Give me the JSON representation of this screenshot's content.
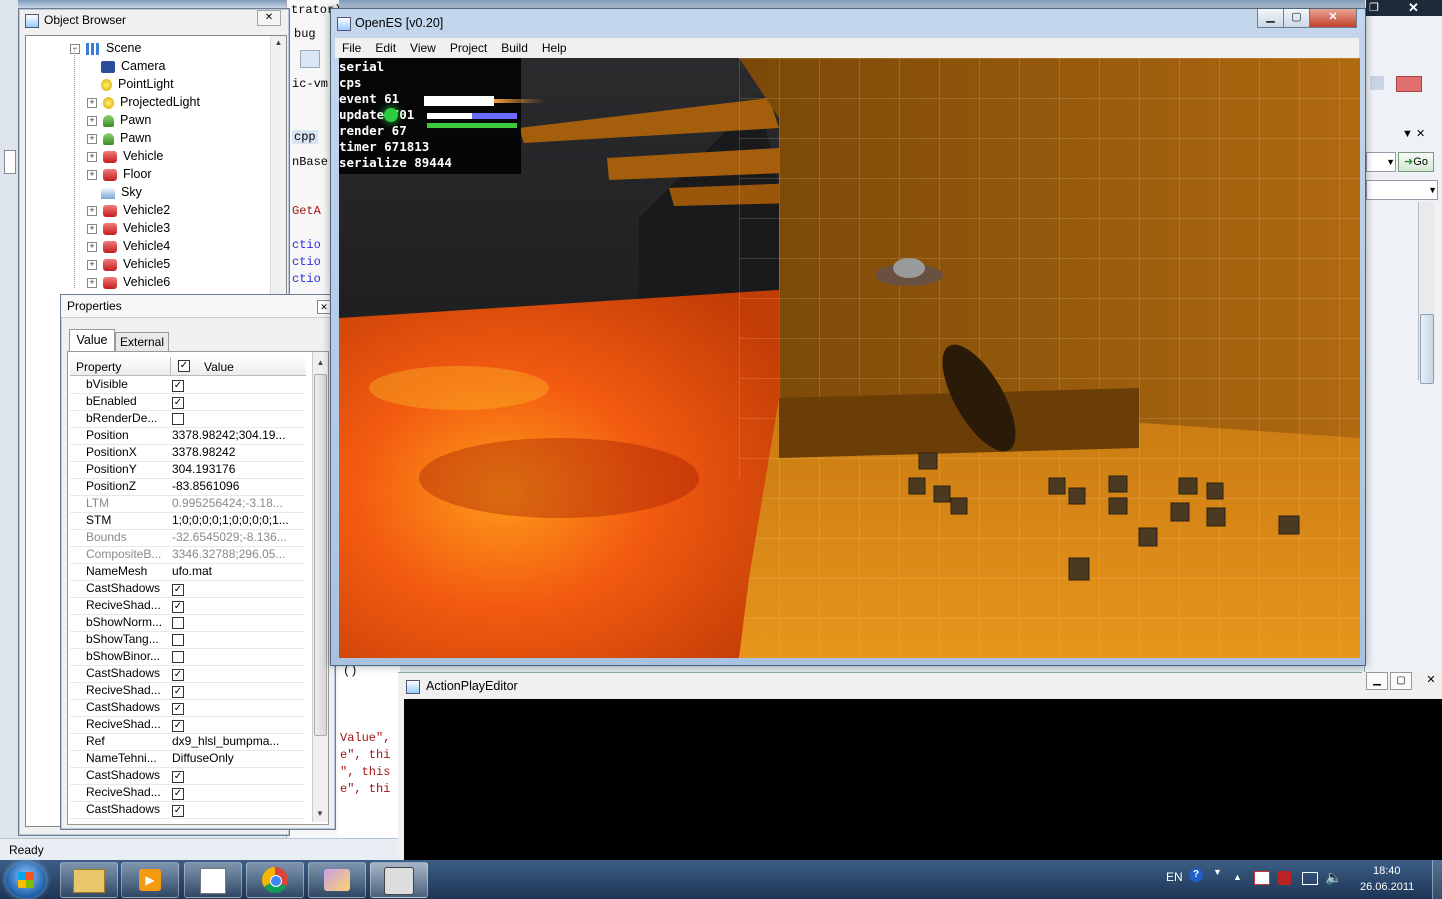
{
  "object_browser": {
    "title": "Object Browser",
    "close_label": "✕",
    "tree": [
      {
        "label": "Scene",
        "icon": "grid-icon",
        "indent": 0,
        "expander": "−"
      },
      {
        "label": "Camera",
        "icon": "camera-icon",
        "indent": 1,
        "expander": ""
      },
      {
        "label": "PointLight",
        "icon": "bulb-icon",
        "indent": 1,
        "expander": ""
      },
      {
        "label": "ProjectedLight",
        "icon": "bulb-icon",
        "indent": 1,
        "expander": "+"
      },
      {
        "label": "Pawn",
        "icon": "pawn-icon",
        "indent": 1,
        "expander": "+"
      },
      {
        "label": "Pawn",
        "icon": "pawn-icon",
        "indent": 1,
        "expander": "+"
      },
      {
        "label": "Vehicle",
        "icon": "car-icon",
        "indent": 1,
        "expander": "+"
      },
      {
        "label": "Floor",
        "icon": "car-icon",
        "indent": 1,
        "expander": "+"
      },
      {
        "label": "Sky",
        "icon": "sky-icon",
        "indent": 1,
        "expander": ""
      },
      {
        "label": "Vehicle2",
        "icon": "car-icon",
        "indent": 1,
        "expander": "+"
      },
      {
        "label": "Vehicle3",
        "icon": "car-icon",
        "indent": 1,
        "expander": "+"
      },
      {
        "label": "Vehicle4",
        "icon": "car-icon",
        "indent": 1,
        "expander": "+"
      },
      {
        "label": "Vehicle5",
        "icon": "car-icon",
        "indent": 1,
        "expander": "+"
      },
      {
        "label": "Vehicle6",
        "icon": "car-icon",
        "indent": 1,
        "expander": "+"
      }
    ]
  },
  "properties": {
    "title": "Properties",
    "close_label": "✕",
    "tabs": [
      {
        "label": "Value"
      },
      {
        "label": "External"
      }
    ],
    "headers": {
      "property": "Property",
      "value": "Value"
    },
    "rows": [
      {
        "name": "bVisible",
        "value": "",
        "check": "✓",
        "muted": false
      },
      {
        "name": "bEnabled",
        "value": "",
        "check": "✓",
        "muted": false
      },
      {
        "name": "bRenderDe...",
        "value": "",
        "check": " ",
        "muted": false
      },
      {
        "name": "Position",
        "value": "3378.98242;304.19...",
        "check": null,
        "muted": false
      },
      {
        "name": "PositionX",
        "value": "3378.98242",
        "check": null,
        "muted": false
      },
      {
        "name": "PositionY",
        "value": "304.193176",
        "check": null,
        "muted": false
      },
      {
        "name": "PositionZ",
        "value": "-83.8561096",
        "check": null,
        "muted": false
      },
      {
        "name": "LTM",
        "value": "0.995256424;-3.18...",
        "check": null,
        "muted": true
      },
      {
        "name": "STM",
        "value": "1;0;0;0;0;1;0;0;0;0;1...",
        "check": null,
        "muted": false
      },
      {
        "name": "Bounds",
        "value": "-32.6545029;-8.136...",
        "check": null,
        "muted": true
      },
      {
        "name": "CompositeB...",
        "value": "3346.32788;296.05...",
        "check": null,
        "muted": true
      },
      {
        "name": "NameMesh",
        "value": "ufo.mat",
        "check": null,
        "muted": false
      },
      {
        "name": "CastShadows",
        "value": "",
        "check": "✓",
        "muted": false
      },
      {
        "name": "ReciveShad...",
        "value": "",
        "check": "✓",
        "muted": false
      },
      {
        "name": "bShowNorm...",
        "value": "",
        "check": " ",
        "muted": false
      },
      {
        "name": "bShowTang...",
        "value": "",
        "check": " ",
        "muted": false
      },
      {
        "name": "bShowBinor...",
        "value": "",
        "check": " ",
        "muted": false
      },
      {
        "name": "CastShadows",
        "value": "",
        "check": "✓",
        "muted": false
      },
      {
        "name": "ReciveShad...",
        "value": "",
        "check": "✓",
        "muted": false
      },
      {
        "name": "CastShadows",
        "value": "",
        "check": "✓",
        "muted": false
      },
      {
        "name": "ReciveShad...",
        "value": "",
        "check": "✓",
        "muted": false
      },
      {
        "name": "Ref",
        "value": "dx9_hlsl_bumpma...",
        "check": null,
        "muted": false
      },
      {
        "name": "NameTehni...",
        "value": "DiffuseOnly",
        "check": null,
        "muted": false
      },
      {
        "name": "CastShadows",
        "value": "",
        "check": "✓",
        "muted": false
      },
      {
        "name": "ReciveShad...",
        "value": "",
        "check": "✓",
        "muted": false
      },
      {
        "name": "CastShadows",
        "value": "",
        "check": "✓",
        "muted": false
      }
    ]
  },
  "openes": {
    "title": "OpenES [v0.20]",
    "menu": [
      "File",
      "Edit",
      "View",
      "Project",
      "Build",
      "Help"
    ],
    "hud": {
      "serial": "serial",
      "cps": "cps",
      "event": "event 61",
      "update": "update 701",
      "render": "render 67",
      "timer": "timer 671813",
      "serialize": "serialize 89444"
    }
  },
  "action_editor": {
    "title": "ActionPlayEditor"
  },
  "ide_background": {
    "fragments": [
      "trator)",
      "bug",
      "ic-vm",
      "cpp",
      "nBase",
      "GetA",
      "ctio",
      "ctio",
      "ctio",
      "()",
      "Value\",",
      "e\", thi",
      "\", this",
      "e\", thi"
    ],
    "go_label": "Go"
  },
  "status_bar": {
    "text": "Ready"
  },
  "taskbar": {
    "language": "EN",
    "time": "18:40",
    "date": "26.06.2011"
  }
}
